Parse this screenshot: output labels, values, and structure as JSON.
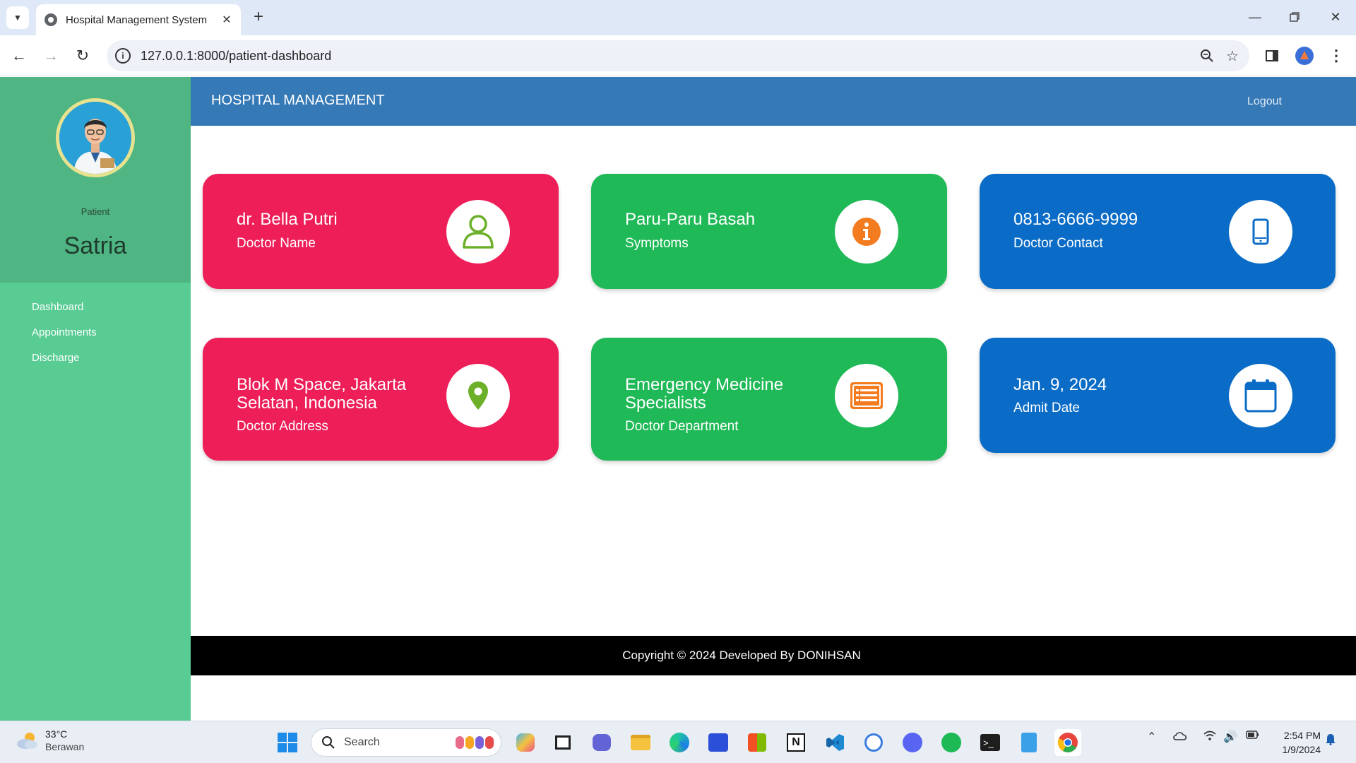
{
  "browser": {
    "tab_title": "Hospital Management System",
    "url": "127.0.0.1:8000/patient-dashboard"
  },
  "sidebar": {
    "role": "Patient",
    "name": "Satria",
    "menu": [
      "Dashboard",
      "Appointments",
      "Discharge"
    ]
  },
  "header": {
    "brand": "HOSPITAL MANAGEMENT",
    "logout": "Logout"
  },
  "cards": [
    {
      "value": "dr. Bella Putri",
      "label": "Doctor Name",
      "color": "#ed1e58",
      "icon": "user-icon"
    },
    {
      "value": "Paru-Paru Basah",
      "label": "Symptoms",
      "color": "#20b958",
      "icon": "info-icon"
    },
    {
      "value": "0813-6666-9999",
      "label": "Doctor Contact",
      "color": "#0a6cc6",
      "icon": "mobile-phone-icon"
    },
    {
      "value": "Blok M Space, Jakarta Selatan, Indonesia",
      "label": "Doctor Address",
      "color": "#ed1e58",
      "icon": "map-pin-icon"
    },
    {
      "value": "Emergency Medicine Specialists",
      "label": "Doctor Department",
      "color": "#20b958",
      "icon": "list-icon"
    },
    {
      "value": "Jan. 9, 2024",
      "label": "Admit Date",
      "color": "#0a6cc6",
      "icon": "calendar-icon"
    }
  ],
  "footer": {
    "text": "Copyright © 2024 Developed By DONIHSAN"
  },
  "taskbar": {
    "temperature": "33°C",
    "weather": "Berawan",
    "search_placeholder": "Search",
    "time": "2:54 PM",
    "date": "1/9/2024"
  }
}
